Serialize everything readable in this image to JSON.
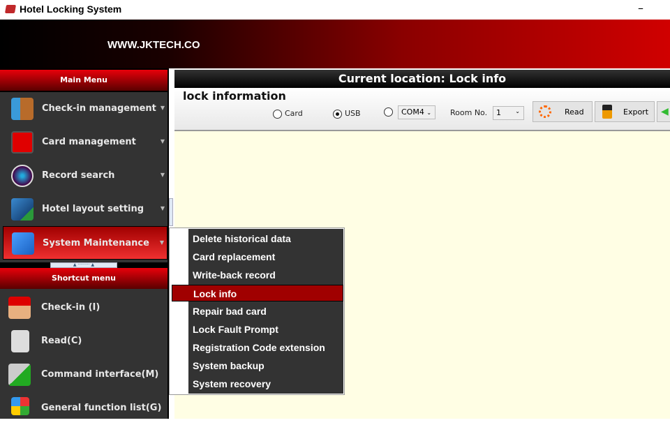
{
  "window": {
    "title": "Hotel Locking System",
    "minimize": "–"
  },
  "banner": {
    "url": "WWW.JKTECH.CO"
  },
  "main_menu": {
    "title": "Main Menu",
    "items": [
      {
        "label": "Check-in management",
        "icon": "door-icon"
      },
      {
        "label": "Card management",
        "icon": "card-icon"
      },
      {
        "label": "Record search",
        "icon": "magnifier-icon"
      },
      {
        "label": "Hotel layout setting",
        "icon": "building-icon"
      },
      {
        "label": "System Maintenance",
        "icon": "tools-icon",
        "selected": true
      }
    ]
  },
  "shortcut_menu": {
    "title": "Shortcut menu",
    "items": [
      {
        "label": "Check-in (I)",
        "icon": "hand-card-icon"
      },
      {
        "label": "Read(C)",
        "icon": "recycle-bin-icon"
      },
      {
        "label": "Command interface(M)",
        "icon": "connector-icon"
      },
      {
        "label": "General function list(G)",
        "icon": "grid-icon"
      }
    ]
  },
  "location": {
    "text": "Current location:  Lock info"
  },
  "toolbar": {
    "heading": "lock information",
    "radio_card": "Card",
    "radio_usb": "USB",
    "port": "COM4",
    "room_label": "Room No.",
    "room_value": "1",
    "read": "Read",
    "export": "Export",
    "selected_radio": "USB"
  },
  "popup": {
    "items": [
      "Delete historical data",
      "Card replacement",
      "Write-back record",
      "Lock info",
      "Repair bad card",
      "Lock Fault Prompt",
      "Registration Code extension",
      "System backup",
      "System recovery"
    ],
    "selected": "Lock info"
  },
  "colors": {
    "accent": "#c00000",
    "panel": "#333333",
    "content": "#fffee4"
  }
}
